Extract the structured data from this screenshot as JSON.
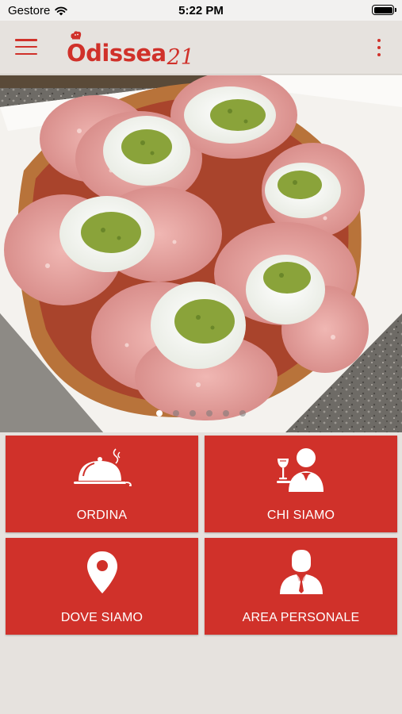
{
  "status_bar": {
    "carrier": "Gestore",
    "time": "5:22 PM"
  },
  "header": {
    "logo_text": "Odissea",
    "logo_number": "21",
    "menu_icon": "hamburger-icon",
    "more_icon": "kebab-menu-icon"
  },
  "carousel": {
    "slide_count": 6,
    "active_index": 0
  },
  "tiles": [
    {
      "label": "ORDINA",
      "icon": "cloche-icon"
    },
    {
      "label": "CHI SIAMO",
      "icon": "waiter-icon"
    },
    {
      "label": "DOVE SIAMO",
      "icon": "location-pin-icon"
    },
    {
      "label": "AREA PERSONALE",
      "icon": "person-icon"
    }
  ],
  "colors": {
    "accent": "#d0312a",
    "background": "#e6e2de",
    "tile_text": "#ffffff"
  }
}
